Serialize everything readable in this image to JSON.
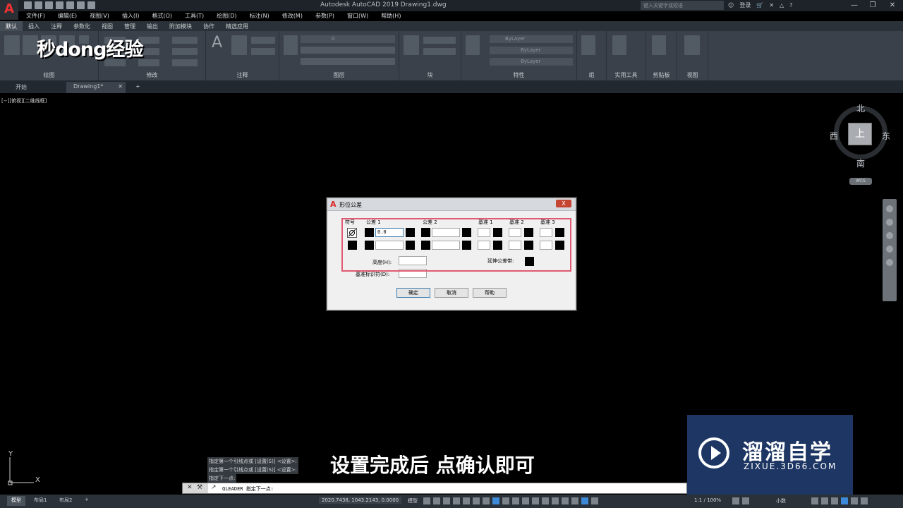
{
  "app": {
    "window_title": "Autodesk AutoCAD 2019    Drawing1.dwg",
    "search_placeholder": "键入关键字或短语",
    "login_label": "登录"
  },
  "menubar": [
    "文件(F)",
    "编辑(E)",
    "视图(V)",
    "插入(I)",
    "格式(O)",
    "工具(T)",
    "绘图(D)",
    "标注(N)",
    "修改(M)",
    "参数(P)",
    "窗口(W)",
    "帮助(H)"
  ],
  "ribbon_tabs": [
    "默认",
    "插入",
    "注释",
    "参数化",
    "视图",
    "管理",
    "输出",
    "附加模块",
    "协作",
    "精选应用"
  ],
  "ribbon_panels": {
    "draw": "绘图",
    "modify": "修改",
    "annotate": "注释",
    "layers": "图层",
    "block": "块",
    "properties": "特性",
    "groups": "组",
    "utilities": "实用工具",
    "clipboard": "剪贴板",
    "view": "视图",
    "bylayer": "ByLayer",
    "layer_value": "0"
  },
  "watermark_logo": "秒dong经验",
  "file_tabs": [
    "开始",
    "Drawing1*"
  ],
  "viewport_label": "[−][俯视][二维线框]",
  "viewcube": {
    "north": "北",
    "south": "南",
    "east": "东",
    "west": "西",
    "face": "上",
    "wcs": "WCS"
  },
  "dialog": {
    "title": "形位公差",
    "close": "X",
    "headers": {
      "symbol": "符号",
      "tol1": "公差 1",
      "tol2": "公差 2",
      "datum1": "基准 1",
      "datum2": "基准 2",
      "datum3": "基准 3"
    },
    "tol1_value": "0.0",
    "height_label": "高度(H):",
    "projected_label": "延伸公差带:",
    "datum_id_label": "基准标识符(D):",
    "ok": "确定",
    "cancel": "取消",
    "help": "帮助"
  },
  "command": {
    "history": [
      "指定第一个引线点或 [设置(S)] <设置>:",
      "指定第一个引线点或 [设置(S)] <设置>:",
      "指定下一点:"
    ],
    "current": "QLEADER 指定下一点:"
  },
  "subtitle": "设置完成后 点确认即可",
  "brand": {
    "name": "溜溜自学",
    "url": "ZIXUE.3D66.COM"
  },
  "ucs": {
    "x": "X",
    "y": "Y"
  },
  "statusbar": {
    "layout_tabs": [
      "模型",
      "布局1",
      "布局2"
    ],
    "coords": "2020.7438, 1043.2143, 0.0000",
    "model": "模型",
    "scale": "1:1 / 100%",
    "units": "小数"
  }
}
